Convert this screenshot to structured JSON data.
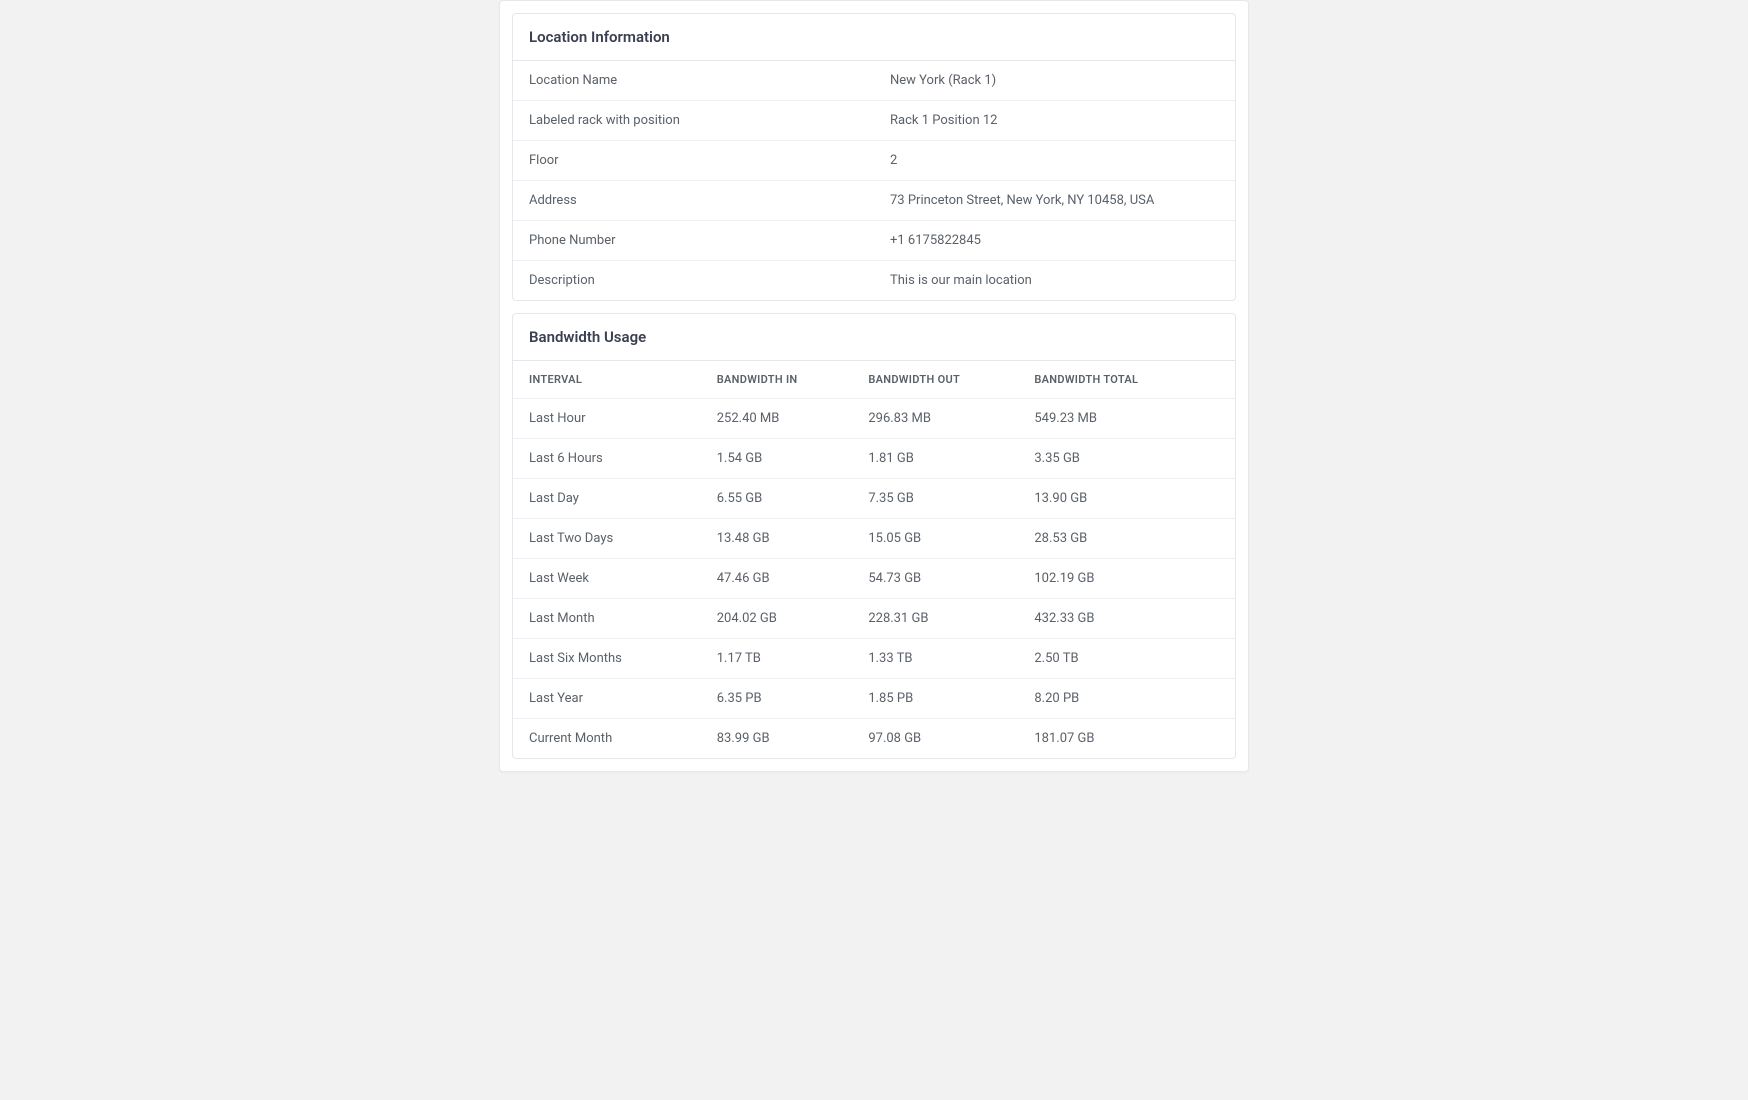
{
  "location": {
    "title": "Location Information",
    "rows": [
      {
        "label": "Location Name",
        "value": "New York (Rack 1)"
      },
      {
        "label": "Labeled rack with position",
        "value": "Rack 1 Position 12"
      },
      {
        "label": "Floor",
        "value": "2"
      },
      {
        "label": "Address",
        "value": "73 Princeton Street, New York, NY 10458, USA"
      },
      {
        "label": "Phone Number",
        "value": "+1 6175822845"
      },
      {
        "label": "Description",
        "value": "This is our main location"
      }
    ]
  },
  "bandwidth": {
    "title": "Bandwidth Usage",
    "headers": [
      "INTERVAL",
      "BANDWIDTH IN",
      "BANDWIDTH OUT",
      "BANDWIDTH TOTAL"
    ],
    "rows": [
      {
        "interval": "Last Hour",
        "in": "252.40 MB",
        "out": "296.83 MB",
        "total": "549.23 MB"
      },
      {
        "interval": "Last 6 Hours",
        "in": "1.54 GB",
        "out": "1.81 GB",
        "total": "3.35 GB"
      },
      {
        "interval": "Last Day",
        "in": "6.55 GB",
        "out": "7.35 GB",
        "total": "13.90 GB"
      },
      {
        "interval": "Last Two Days",
        "in": "13.48 GB",
        "out": "15.05 GB",
        "total": "28.53 GB"
      },
      {
        "interval": "Last Week",
        "in": "47.46 GB",
        "out": "54.73 GB",
        "total": "102.19 GB"
      },
      {
        "interval": "Last Month",
        "in": "204.02 GB",
        "out": "228.31 GB",
        "total": "432.33 GB"
      },
      {
        "interval": "Last Six Months",
        "in": "1.17 TB",
        "out": "1.33 TB",
        "total": "2.50 TB"
      },
      {
        "interval": "Last Year",
        "in": "6.35 PB",
        "out": "1.85 PB",
        "total": "8.20 PB"
      },
      {
        "interval": "Current Month",
        "in": "83.99 GB",
        "out": "97.08 GB",
        "total": "181.07 GB"
      }
    ]
  }
}
